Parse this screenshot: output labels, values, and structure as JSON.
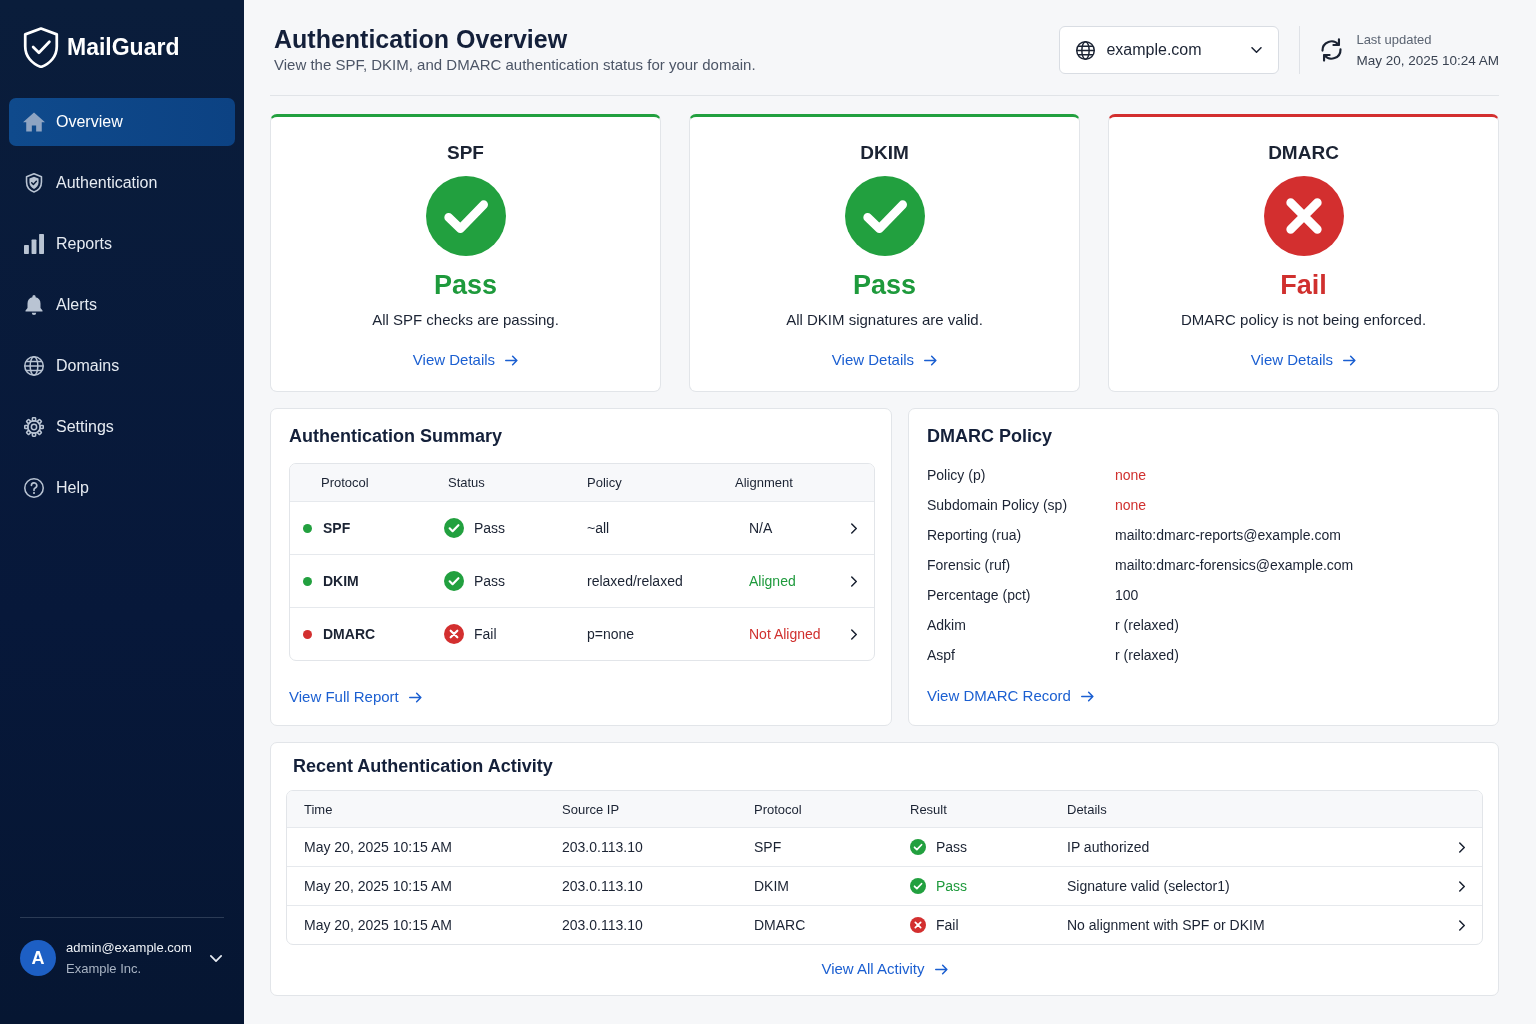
{
  "sidebar": {
    "brand": "MailGuard",
    "nav": [
      {
        "label": "Overview",
        "selected": true
      },
      {
        "label": "Authentication",
        "selected": false
      },
      {
        "label": "Reports",
        "selected": false
      },
      {
        "label": "Alerts",
        "selected": false
      },
      {
        "label": "Domains",
        "selected": false
      },
      {
        "label": "Settings",
        "selected": false
      },
      {
        "label": "Help",
        "selected": false
      }
    ],
    "user": {
      "initial": "A",
      "email": "admin@example.com",
      "organization": "Example Inc."
    }
  },
  "header": {
    "title": "Authentication Overview",
    "subtitle": "View the SPF, DKIM, and DMARC authentication status for your domain.",
    "domain_select": {
      "value": "example.com"
    },
    "last_updated": {
      "label": "Last updated",
      "time": "May 20, 2025 10:24 AM"
    }
  },
  "status_cards": [
    {
      "title": "SPF",
      "passed": true,
      "result": "Pass",
      "description": "All SPF checks are passing.",
      "link": "View Details"
    },
    {
      "title": "DKIM",
      "passed": true,
      "result": "Pass",
      "description": "All DKIM signatures are valid.",
      "link": "View Details"
    },
    {
      "title": "DMARC",
      "passed": false,
      "result": "Fail",
      "description": "DMARC policy is not being enforced.",
      "link": "View Details"
    }
  ],
  "summary": {
    "title": "Authentication Summary",
    "columns": [
      "Protocol",
      "Status",
      "Policy",
      "Alignment"
    ],
    "rows": [
      {
        "protocol": "SPF",
        "color": "#22a03f",
        "passed": true,
        "status": "Pass",
        "policy": "~all",
        "alignment": "N/A",
        "kind": "neutral"
      },
      {
        "protocol": "DKIM",
        "color": "#22a03f",
        "passed": true,
        "status": "Pass",
        "policy": "relaxed/relaxed",
        "alignment": "Aligned",
        "kind": "ok"
      },
      {
        "protocol": "DMARC",
        "color": "#d32f2f",
        "passed": false,
        "status": "Fail",
        "policy": "p=none",
        "alignment": "Not Aligned",
        "kind": "bad"
      }
    ],
    "link": "View Full Report"
  },
  "dmarc_policy": {
    "title": "DMARC Policy",
    "fields": [
      {
        "label": "Policy (p)",
        "value": "none",
        "warning": true
      },
      {
        "label": "Subdomain Policy (sp)",
        "value": "none",
        "warning": true
      },
      {
        "label": "Reporting (rua)",
        "value": "mailto:dmarc-reports@example.com",
        "warning": false
      },
      {
        "label": "Forensic (ruf)",
        "value": "mailto:dmarc-forensics@example.com",
        "warning": false
      },
      {
        "label": "Percentage (pct)",
        "value": "100",
        "warning": false
      },
      {
        "label": "Adkim",
        "value": "r (relaxed)",
        "warning": false
      },
      {
        "label": "Aspf",
        "value": "r (relaxed)",
        "warning": false
      }
    ],
    "link": "View DMARC Record"
  },
  "activity": {
    "title": "Recent Authentication Activity",
    "columns": [
      "Time",
      "Source IP",
      "Protocol",
      "Result",
      "Details"
    ],
    "rows": [
      {
        "time": "May 20, 2025 10:15 AM",
        "source_ip": "203.0.113.10",
        "protocol": "SPF",
        "passed": true,
        "result": "Pass",
        "result_colored": false,
        "details": "IP authorized"
      },
      {
        "time": "May 20, 2025 10:15 AM",
        "source_ip": "203.0.113.10",
        "protocol": "DKIM",
        "passed": true,
        "result": "Pass",
        "result_colored": true,
        "details": "Signature valid (selector1)"
      },
      {
        "time": "May 20, 2025 10:15 AM",
        "source_ip": "203.0.113.10",
        "protocol": "DMARC",
        "passed": false,
        "result": "Fail",
        "result_colored": false,
        "details": "No alignment with SPF or DKIM"
      }
    ],
    "link": "View All Activity"
  }
}
